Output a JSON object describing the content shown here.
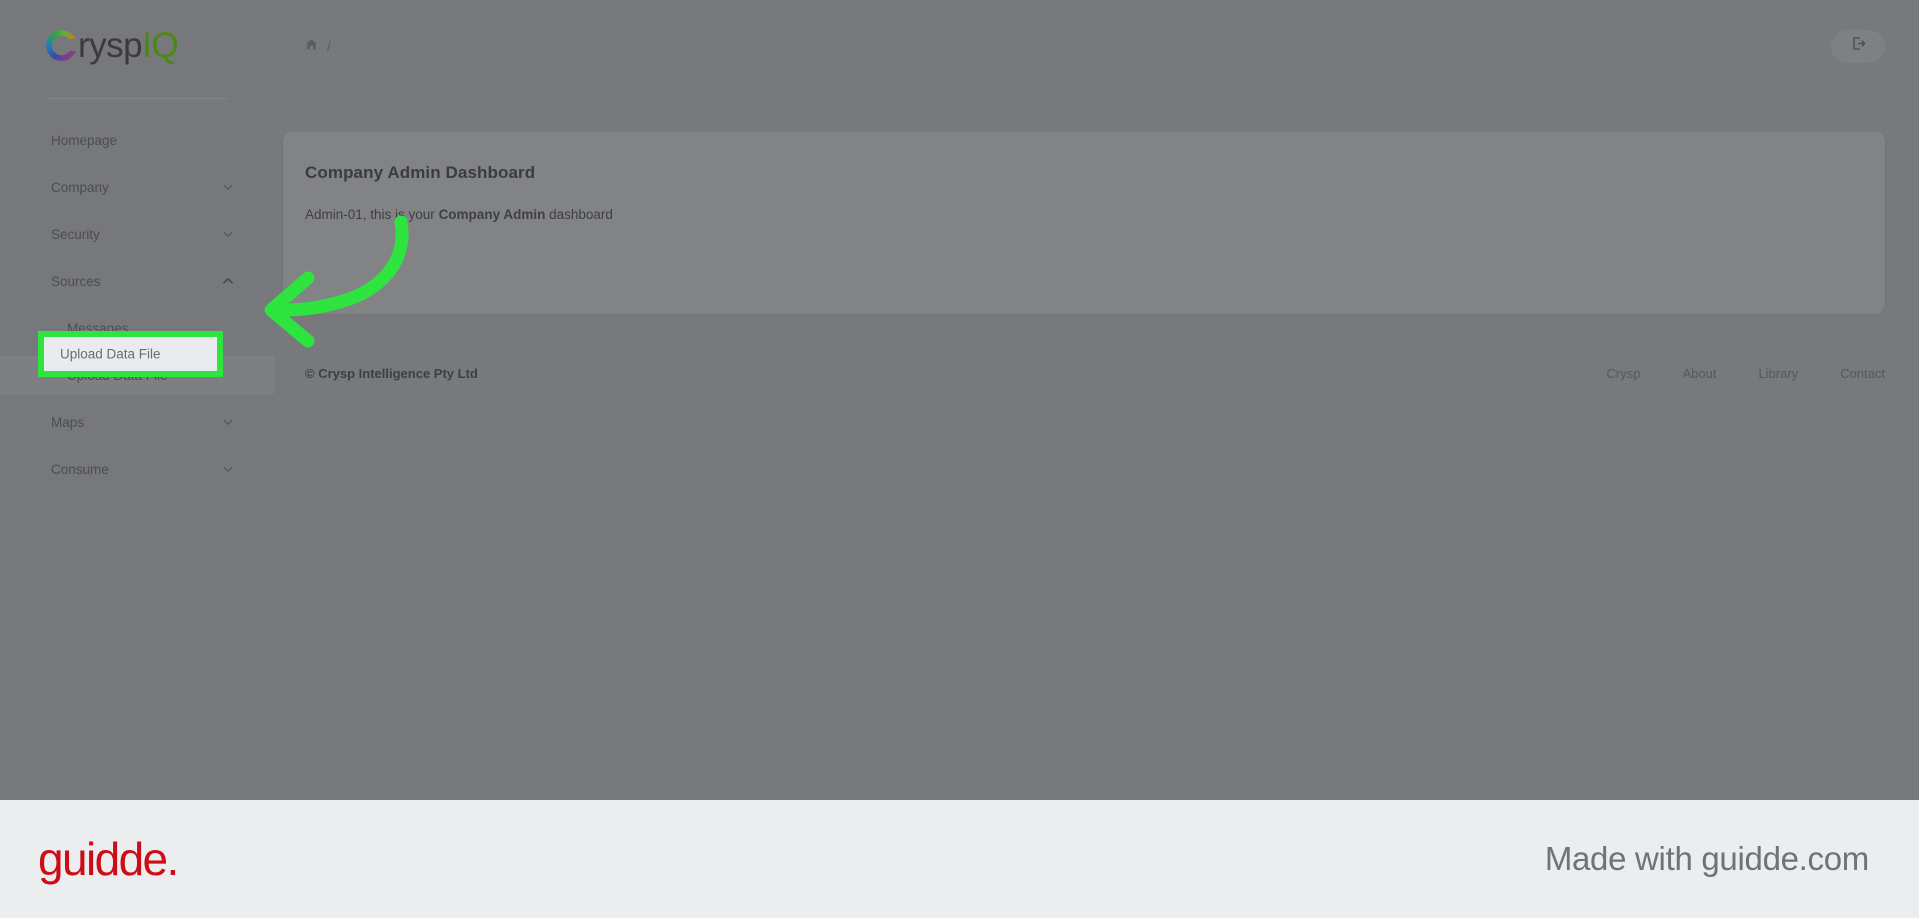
{
  "brand": {
    "logo_text_dark": "rysp",
    "logo_text_green": "IQ",
    "logo_full": "CryspIQ",
    "mark_icon": "crysp-circle-icon",
    "accent_green": "#4a8a12"
  },
  "sidebar": {
    "items": [
      {
        "label": "Homepage",
        "icon": null,
        "level": "top",
        "expanded": null
      },
      {
        "label": "Company",
        "icon": "chevron-down-icon",
        "level": "top",
        "expanded": false
      },
      {
        "label": "Security",
        "icon": "chevron-down-icon",
        "level": "top",
        "expanded": false
      },
      {
        "label": "Sources",
        "icon": "chevron-up-icon",
        "level": "top",
        "expanded": true
      },
      {
        "label": "Messages",
        "icon": null,
        "level": "sub",
        "expanded": null
      },
      {
        "label": "Upload Data File",
        "icon": null,
        "level": "sub",
        "expanded": null
      },
      {
        "label": "Maps",
        "icon": "chevron-down-icon",
        "level": "top",
        "expanded": false
      },
      {
        "label": "Consume",
        "icon": "chevron-down-icon",
        "level": "top",
        "expanded": false
      }
    ]
  },
  "topbar": {
    "breadcrumb": {
      "home_icon": "home-icon",
      "separator": "/"
    },
    "logout_icon": "logout-icon"
  },
  "main": {
    "card": {
      "title": "Company Admin Dashboard",
      "greeting_prefix": "Admin-01, this is your ",
      "greeting_bold": "Company Admin",
      "greeting_suffix": " dashboard"
    }
  },
  "page_footer": {
    "copyright": "© Crysp Intelligence Pty Ltd",
    "links": [
      "Crysp",
      "About",
      "Library",
      "Contact"
    ]
  },
  "annotation": {
    "highlight_target_label": "Upload Data File",
    "highlight_color": "#2ee53f",
    "arrow_icon": "curved-arrow-left-icon",
    "arrow_color": "#2ee53f"
  },
  "guidde_bar": {
    "logo": "guidde.",
    "tagline": "Made with guidde.com",
    "logo_color": "#cc0c16"
  }
}
